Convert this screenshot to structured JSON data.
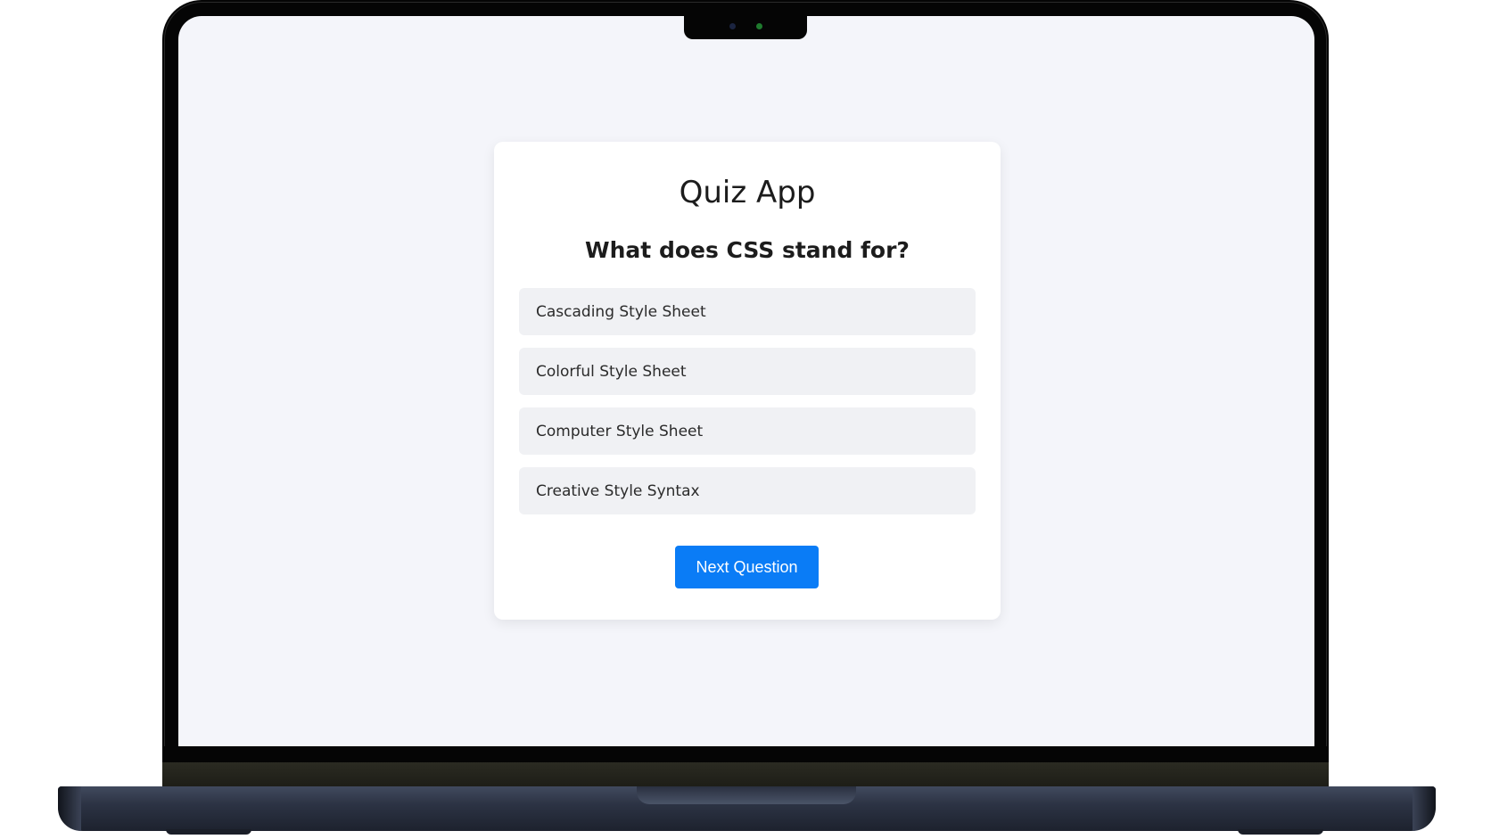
{
  "quiz": {
    "title": "Quiz App",
    "question": "What does CSS stand for?",
    "options": [
      {
        "label": "Cascading Style Sheet"
      },
      {
        "label": "Colorful Style Sheet"
      },
      {
        "label": "Computer Style Sheet"
      },
      {
        "label": "Creative Style Syntax"
      }
    ],
    "next_button_label": "Next Question"
  },
  "colors": {
    "page_background": "#f4f5fa",
    "card_background": "#ffffff",
    "option_background": "#f0f1f4",
    "button_accent": "#0a7cf6",
    "laptop_body": "#2c3344"
  },
  "icons": [
    "camera-icon",
    "camera-indicator-icon"
  ]
}
